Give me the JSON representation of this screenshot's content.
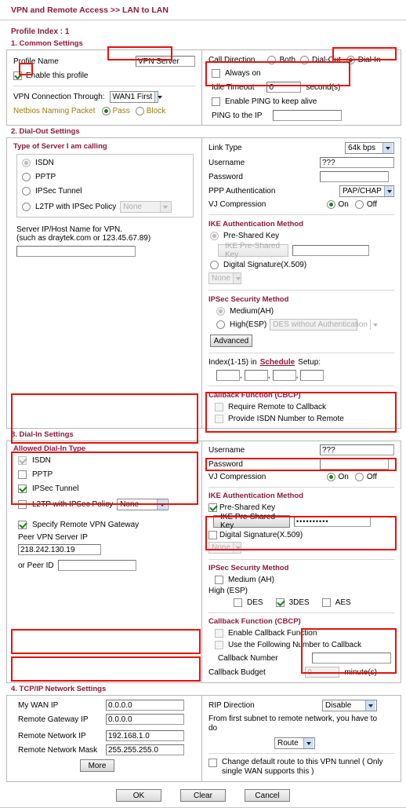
{
  "header": {
    "title": "VPN and Remote Access >> LAN to LAN"
  },
  "profile_index": "Profile Index : 1",
  "section1": {
    "title": "1. Common Settings",
    "profile_name_label": "Profile Name",
    "profile_name_value": "VPN Server",
    "enable_profile_label": "Enable this profile",
    "enable_profile_checked": true,
    "vpn_connection_label": "VPN Connection Through:",
    "vpn_connection_value": "WAN1 First",
    "netbios_label": "Netbios Naming Packet",
    "netbios_pass": "Pass",
    "netbios_block": "Block",
    "call_direction_label": "Call Direction",
    "call_both": "Both",
    "call_dialout": "Dial-Out",
    "call_dialin": "Dial-In",
    "always_on_label": "Always on",
    "idle_timeout_label": "Idle Timeout",
    "idle_timeout_value": "0",
    "idle_timeout_unit": "second(s)",
    "enable_ping_label": "Enable PING to keep alive",
    "ping_ip_label": "PING to the IP",
    "ping_ip_value": ""
  },
  "section2": {
    "title": "2. Dial-Out Settings",
    "type_title": "Type of Server I am calling",
    "types": [
      "ISDN",
      "PPTP",
      "IPSec Tunnel",
      "L2TP with IPSec Policy"
    ],
    "l2tp_policy_value": "None",
    "server_hint_line1": "Server IP/Host Name for VPN.",
    "server_hint_line2": "(such as draytek.com or 123.45.67.89)",
    "server_value": "",
    "link_type_label": "Link Type",
    "link_type_value": "64k bps",
    "username_label": "Username",
    "username_value": "???",
    "password_label": "Password",
    "password_value": "",
    "ppp_auth_label": "PPP Authentication",
    "ppp_auth_value": "PAP/CHAP",
    "vj_label": "VJ Compression",
    "vj_on": "On",
    "vj_off": "Off",
    "ike_title": "IKE Authentication Method",
    "psk_label": "Pre-Shared Key",
    "psk_button": "IKE Pre-Shared Key",
    "psk_value": "",
    "digital_sig_label": "Digital Signature(X.509)",
    "digital_sig_value": "None",
    "ipsec_title": "IPSec Security Method",
    "medium_label": "Medium(AH)",
    "high_label": "High(ESP)",
    "high_value": "DES without Authentication",
    "advanced_button": "Advanced",
    "schedule_pre": "Index(1-15) in",
    "schedule_link": "Schedule",
    "schedule_post": "Setup:",
    "schedule_values": [
      "",
      "",
      "",
      ""
    ],
    "cbcp_title": "Callback Function (CBCP)",
    "require_callback": "Require Remote to Callback",
    "provide_isdn": "Provide ISDN Number to Remote"
  },
  "section3": {
    "title": "3. Dial-In Settings",
    "allowed_title": "Allowed Dial-In Type",
    "types": [
      "ISDN",
      "PPTP",
      "IPSec Tunnel",
      "L2TP with IPSec Policy"
    ],
    "isdn_checked": true,
    "pptp_checked": false,
    "ipsec_checked": true,
    "l2tp_checked": false,
    "l2tp_policy_value": "None",
    "specify_gateway_label": "Specify Remote VPN Gateway",
    "specify_gateway_checked": true,
    "peer_ip_label": "Peer VPN Server IP",
    "peer_ip_value": "218.242.130.19",
    "peer_id_label": "or Peer ID",
    "peer_id_value": "",
    "username_label": "Username",
    "username_value": "???",
    "password_label": "Password",
    "password_value": "",
    "vj_label": "VJ Compression",
    "vj_on": "On",
    "vj_off": "Off",
    "ike_title": "IKE Authentication Method",
    "psk_label": "Pre-Shared Key",
    "psk_checked": true,
    "psk_button": "IKE Pre-Shared Key",
    "psk_value": "••••••••••",
    "digital_sig_label": "Digital Signature(X.509)",
    "digital_sig_value": "None",
    "ipsec_title": "IPSec Security Method",
    "medium_label": "Medium (AH)",
    "high_label": "High (ESP)",
    "des_label": "DES",
    "des3_label": "3DES",
    "aes_label": "AES",
    "des_checked": false,
    "des3_checked": true,
    "aes_checked": false,
    "cbcp_title": "Callback Function (CBCP)",
    "enable_callback": "Enable Callback Function",
    "use_number_callback": "Use the Following Number to Callback",
    "callback_number_label": "Callback Number",
    "callback_number_value": "",
    "callback_budget_label": "Callback Budget",
    "callback_budget_value": "0",
    "callback_budget_unit": "minute(s)"
  },
  "section4": {
    "title": "4. TCP/IP Network Settings",
    "my_wan_ip_label": "My WAN IP",
    "my_wan_ip_value": "0.0.0.0",
    "remote_gw_label": "Remote Gateway IP",
    "remote_gw_value": "0.0.0.0",
    "remote_net_ip_label": "Remote Network IP",
    "remote_net_ip_value": "192.168.1.0",
    "remote_net_mask_label": "Remote Network Mask",
    "remote_net_mask_value": "255.255.255.0",
    "more_button": "More",
    "rip_label": "RIP Direction",
    "rip_value": "Disable",
    "from_subnet_text": "From first subnet to remote network, you have to do",
    "route_value": "Route",
    "change_route_label": "Change default route to this VPN tunnel ( Only single WAN supports this )"
  },
  "footer": {
    "ok": "OK",
    "clear": "Clear",
    "cancel": "Cancel"
  },
  "colors": {
    "accent": "#8b1a3a",
    "highlight": "#e8120b",
    "olive": "#9c7a10",
    "check": "#17820f"
  }
}
